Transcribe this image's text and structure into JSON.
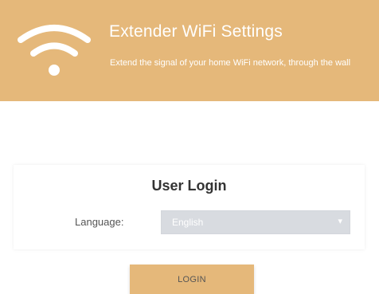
{
  "header": {
    "title": "Extender WiFi Settings",
    "description": "Extend the signal of your home WiFi network, through the wall",
    "icon": "wifi-icon",
    "background_color": "#e5b87a"
  },
  "login": {
    "title": "User Login",
    "language_label": "Language:",
    "language_value": "English",
    "language_options": [
      "English"
    ],
    "button_label": "LOGIN",
    "dropdown_icon": "up-down-arrows-icon"
  }
}
